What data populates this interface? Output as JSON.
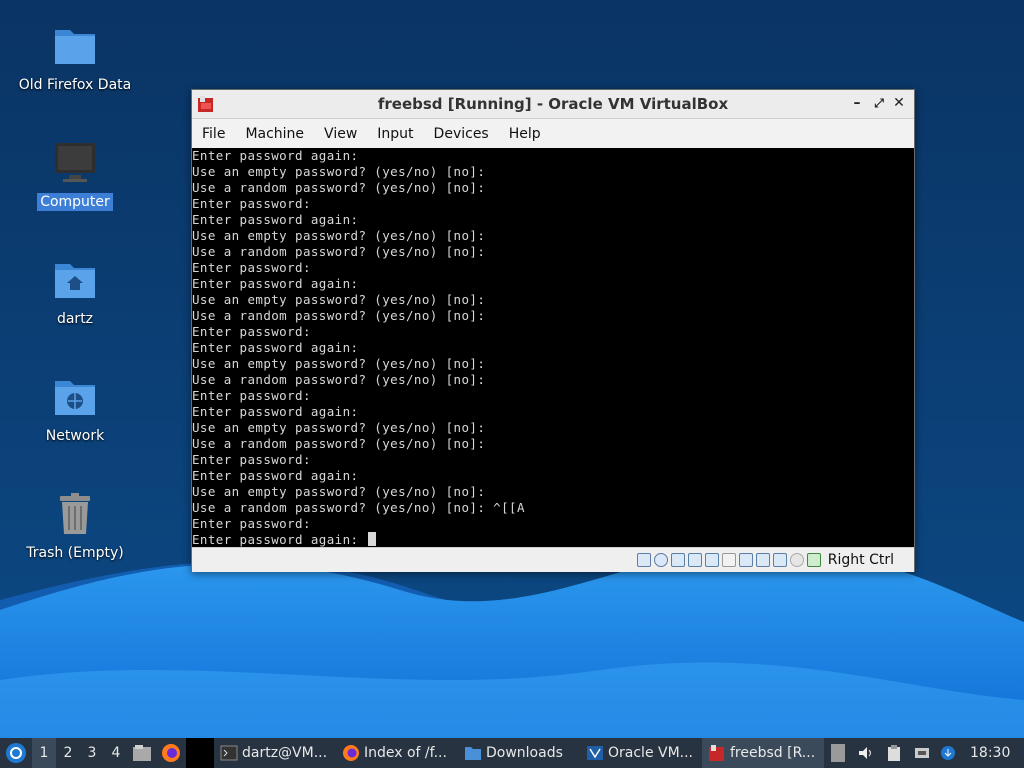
{
  "desktop": {
    "icons": [
      {
        "label": "Old Firefox Data"
      },
      {
        "label": "Computer"
      },
      {
        "label": "dartz"
      },
      {
        "label": "Network"
      },
      {
        "label": "Trash (Empty)"
      }
    ]
  },
  "window": {
    "title": "freebsd [Running] - Oracle VM VirtualBox",
    "menu": [
      "File",
      "Machine",
      "View",
      "Input",
      "Devices",
      "Help"
    ],
    "host_key": "Right Ctrl"
  },
  "terminal": {
    "lines": [
      "Enter password again:",
      "Use an empty password? (yes/no) [no]:",
      "Use a random password? (yes/no) [no]:",
      "Enter password:",
      "Enter password again:",
      "Use an empty password? (yes/no) [no]:",
      "Use a random password? (yes/no) [no]:",
      "Enter password:",
      "Enter password again:",
      "Use an empty password? (yes/no) [no]:",
      "Use a random password? (yes/no) [no]:",
      "Enter password:",
      "Enter password again:",
      "Use an empty password? (yes/no) [no]:",
      "Use a random password? (yes/no) [no]:",
      "Enter password:",
      "Enter password again:",
      "Use an empty password? (yes/no) [no]:",
      "Use a random password? (yes/no) [no]:",
      "Enter password:",
      "Enter password again:",
      "Use an empty password? (yes/no) [no]:",
      "Use a random password? (yes/no) [no]: ^[[A",
      "Enter password:",
      "Enter password again: "
    ]
  },
  "taskbar": {
    "workspaces": [
      "1",
      "2",
      "3",
      "4"
    ],
    "active_workspace": "1",
    "tasks": [
      {
        "label": "dartz@VM...",
        "icon": "terminal-icon"
      },
      {
        "label": "Index of /f...",
        "icon": "firefox-icon"
      },
      {
        "label": "Downloads",
        "icon": "folder-icon"
      },
      {
        "label": "Oracle VM...",
        "icon": "virtualbox-icon"
      },
      {
        "label": "freebsd [R...",
        "icon": "virtualbox-vm-icon"
      }
    ],
    "clock": "18:30"
  },
  "colors": {
    "desktop_bg": "#0b3a6b",
    "wave": "#1e88e5",
    "taskbar": "#273340",
    "selection": "#3d7fd6"
  }
}
